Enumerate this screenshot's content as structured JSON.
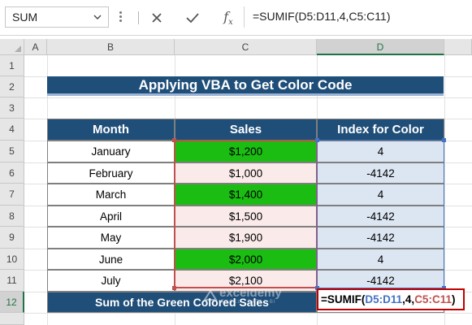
{
  "formula_bar": {
    "name_box": "SUM",
    "cancel_icon": "close-icon",
    "enter_icon": "check-icon",
    "fx_label": "fx",
    "formula": "=SUMIF(D5:D11,4,C5:C11)"
  },
  "columns": [
    "A",
    "B",
    "C",
    "D"
  ],
  "rows": [
    "1",
    "2",
    "3",
    "4",
    "5",
    "6",
    "7",
    "8",
    "9",
    "10",
    "11",
    "12"
  ],
  "title": "Applying VBA to Get Color Code",
  "table": {
    "headers": [
      "Month",
      "Sales",
      "Index for Color"
    ],
    "rows": [
      {
        "month": "January",
        "sales": "$1,200",
        "index": "4",
        "green": true
      },
      {
        "month": "February",
        "sales": "$1,000",
        "index": "-4142",
        "green": false
      },
      {
        "month": "March",
        "sales": "$1,400",
        "index": "4",
        "green": true
      },
      {
        "month": "April",
        "sales": "$1,500",
        "index": "-4142",
        "green": false
      },
      {
        "month": "May",
        "sales": "$1,900",
        "index": "-4142",
        "green": false
      },
      {
        "month": "June",
        "sales": "$2,000",
        "index": "4",
        "green": true
      },
      {
        "month": "July",
        "sales": "$2,100",
        "index": "-4142",
        "green": false
      }
    ],
    "sum_label": "Sum of the Green Colored Sales"
  },
  "edit_formula": {
    "p1": "=SUMIF(",
    "p2": "D5:D11",
    "p3": ",4,",
    "p4": "C5:C11",
    "p5": ")"
  },
  "watermark": {
    "line1": "exceldemy",
    "line2": "EXCEL · DATA · BI"
  },
  "colors": {
    "header_blue": "#1f4e79",
    "green_fill": "#1bbd12",
    "pink_fill": "#fbeaea",
    "index_fill": "#dce6f2",
    "range_red": "#c0504d",
    "range_blue": "#4472c4"
  }
}
